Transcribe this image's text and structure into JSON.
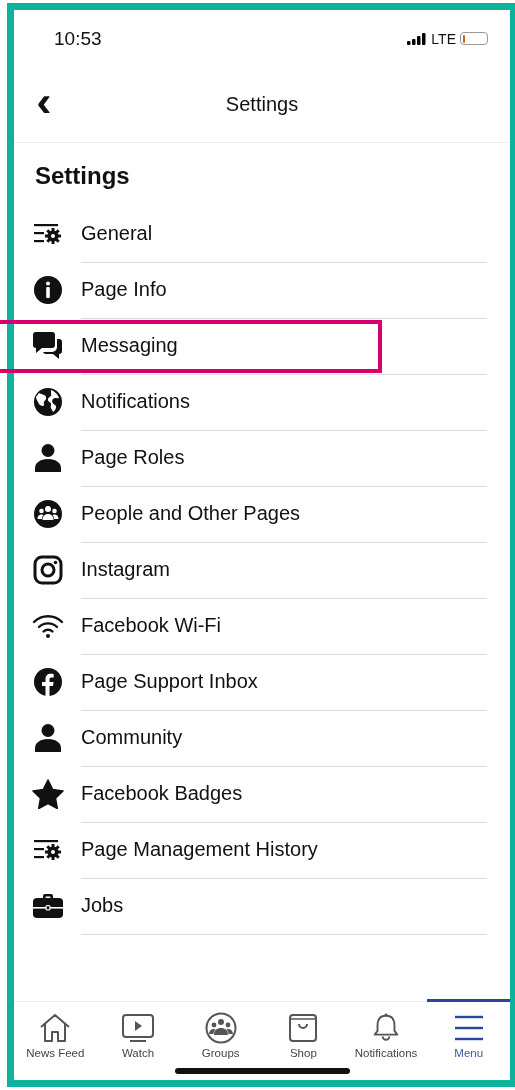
{
  "status_bar": {
    "time": "10:53",
    "network": "LTE",
    "battery": {
      "level": 0.12
    }
  },
  "nav_bar": {
    "back": "‹",
    "title": "Settings"
  },
  "heading": "Settings",
  "items": [
    {
      "kind": "sliders-gear",
      "label": "General",
      "highlighted": false
    },
    {
      "kind": "info",
      "label": "Page Info",
      "highlighted": false
    },
    {
      "kind": "chat",
      "label": "Messaging",
      "highlighted": true
    },
    {
      "kind": "globe",
      "label": "Notifications",
      "highlighted": false
    },
    {
      "kind": "person",
      "label": "Page Roles",
      "highlighted": false
    },
    {
      "kind": "people",
      "label": "People and Other Pages",
      "highlighted": false
    },
    {
      "kind": "camera",
      "label": "Instagram",
      "highlighted": false
    },
    {
      "kind": "wifi",
      "label": "Facebook Wi-Fi",
      "highlighted": false
    },
    {
      "kind": "f-circle",
      "label": "Page Support Inbox",
      "highlighted": false
    },
    {
      "kind": "person",
      "label": "Community",
      "highlighted": false
    },
    {
      "kind": "star",
      "label": "Facebook Badges",
      "highlighted": false
    },
    {
      "kind": "sliders-gear",
      "label": "Page Management History",
      "highlighted": false
    },
    {
      "kind": "briefcase",
      "label": "Jobs",
      "highlighted": false
    }
  ],
  "tab_bar": [
    {
      "kind": "home",
      "label": "News Feed",
      "selected": false
    },
    {
      "kind": "video",
      "label": "Watch",
      "selected": false
    },
    {
      "kind": "groups",
      "label": "Groups",
      "selected": false
    },
    {
      "kind": "shop",
      "label": "Shop",
      "selected": false
    },
    {
      "kind": "bell",
      "label": "Notifications",
      "selected": false
    },
    {
      "kind": "menu",
      "label": "Menu",
      "selected": true
    }
  ]
}
